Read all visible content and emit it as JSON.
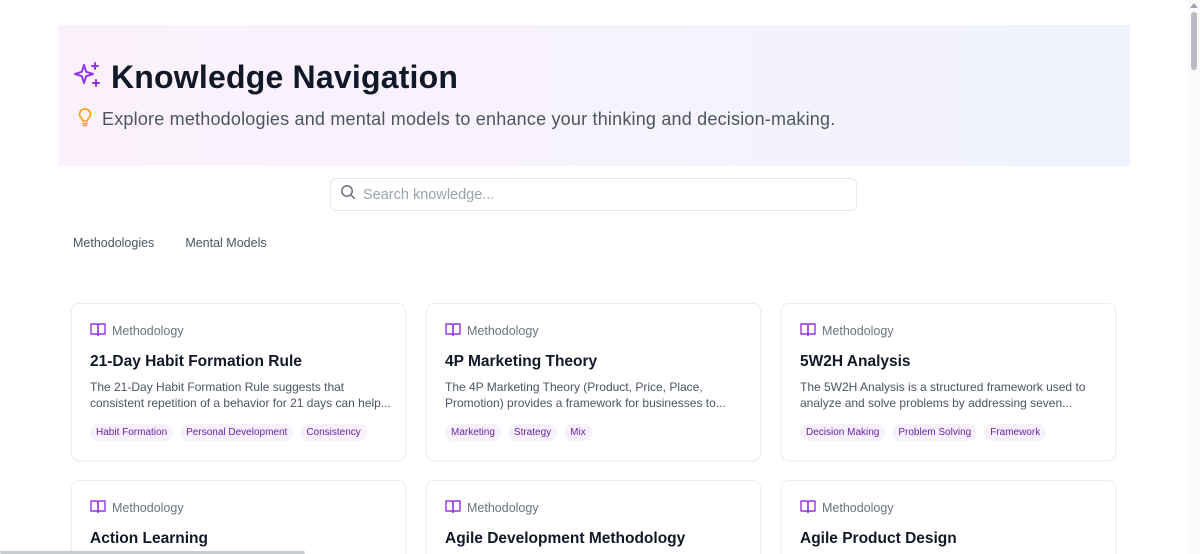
{
  "header": {
    "title": "Knowledge Navigation",
    "subtitle": "Explore methodologies and mental models to enhance your thinking and decision-making.",
    "title_icon": "sparkles-icon",
    "subtitle_icon": "lightbulb-icon"
  },
  "search": {
    "placeholder": "Search knowledge...",
    "value": ""
  },
  "tabs": [
    {
      "label": "Methodologies"
    },
    {
      "label": "Mental Models"
    }
  ],
  "colors": {
    "accent": "#9333ea",
    "tag_bg": "#f7f1fb",
    "tag_text": "#6b21a8",
    "hero_start": "#fbf1fb",
    "hero_end": "#eff3fd"
  },
  "cards": [
    {
      "type": "Methodology",
      "title": "21-Day Habit Formation Rule",
      "desc_line1": "The 21-Day Habit Formation Rule suggests that",
      "desc_line2": "consistent repetition of a behavior for 21 days can help...",
      "tags": [
        "Habit Formation",
        "Personal Development",
        "Consistency"
      ]
    },
    {
      "type": "Methodology",
      "title": "4P Marketing Theory",
      "desc_line1": "The 4P Marketing Theory (Product, Price, Place,",
      "desc_line2": "Promotion) provides a framework for businesses to...",
      "tags": [
        "Marketing",
        "Strategy",
        "Mix"
      ]
    },
    {
      "type": "Methodology",
      "title": "5W2H Analysis",
      "desc_line1": "The 5W2H Analysis is a structured framework used to",
      "desc_line2": "analyze and solve problems by addressing seven...",
      "tags": [
        "Decision Making",
        "Problem Solving",
        "Framework"
      ]
    },
    {
      "type": "Methodology",
      "title": "Action Learning"
    },
    {
      "type": "Methodology",
      "title": "Agile Development Methodology"
    },
    {
      "type": "Methodology",
      "title": "Agile Product Design"
    }
  ]
}
